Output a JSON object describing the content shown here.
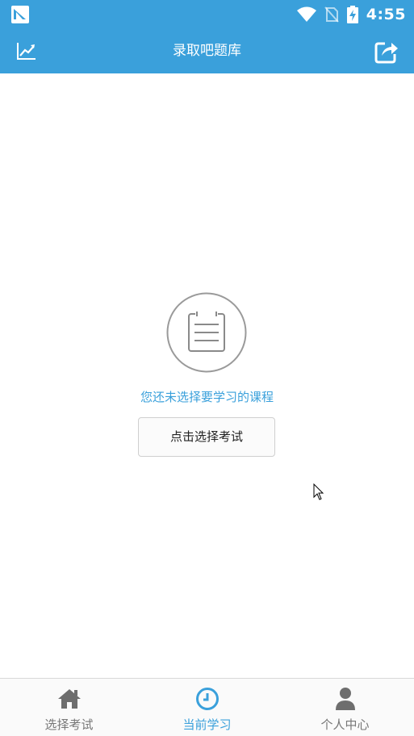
{
  "status_bar": {
    "time": "4:55",
    "icons": [
      "app-logo-icon",
      "wifi-icon",
      "no-sim-icon",
      "battery-charging-icon"
    ]
  },
  "toolbar": {
    "title": "录取吧题库",
    "left_icon": "trend-chart-icon",
    "right_icon": "share-icon"
  },
  "empty_state": {
    "icon": "document-icon",
    "message": "您还未选择要学习的课程",
    "button_label": "点击选择考试"
  },
  "bottom_nav": {
    "items": [
      {
        "label": "选择考试",
        "icon": "home-icon",
        "active": false
      },
      {
        "label": "当前学习",
        "icon": "clock-icon",
        "active": true
      },
      {
        "label": "个人中心",
        "icon": "person-icon",
        "active": false
      }
    ]
  },
  "colors": {
    "accent": "#3aa0db",
    "inactive": "#777777"
  }
}
